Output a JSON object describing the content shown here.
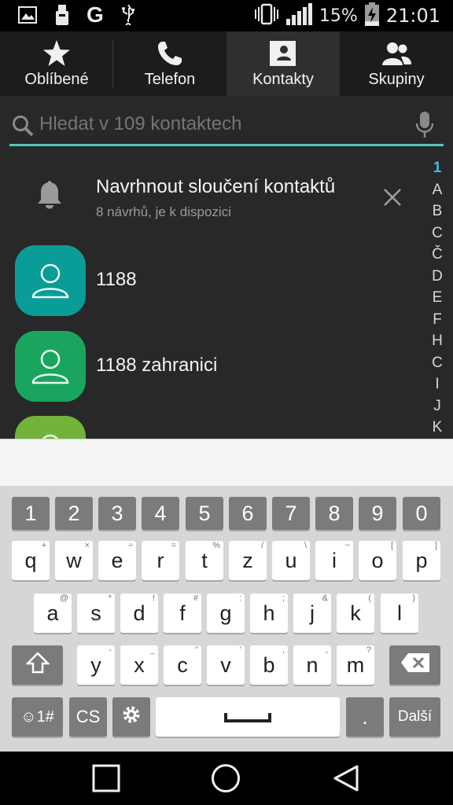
{
  "status": {
    "battery": "15%",
    "time": "21:01"
  },
  "tabs": [
    {
      "label": "Oblíbené",
      "icon": "star-icon"
    },
    {
      "label": "Telefon",
      "icon": "phone-icon"
    },
    {
      "label": "Kontakty",
      "icon": "contacts-icon",
      "active": true
    },
    {
      "label": "Skupiny",
      "icon": "groups-icon"
    }
  ],
  "search": {
    "placeholder": "Hledat v 109 kontaktech"
  },
  "suggestion": {
    "title": "Navrhnout sloučení kontaktů",
    "subtitle": "8 návrhů, je k dispozici"
  },
  "contacts": [
    {
      "name": "1188",
      "color": "#0a9c96"
    },
    {
      "name": "1188 zahranici",
      "color": "#1aa55e"
    },
    {
      "name": "",
      "color": "#74b33a"
    }
  ],
  "alphabet": [
    "1",
    "A",
    "B",
    "C",
    "Č",
    "D",
    "E",
    "F",
    "H",
    "C",
    "I",
    "J",
    "K"
  ],
  "keyboard": {
    "numbers": [
      "1",
      "2",
      "3",
      "4",
      "5",
      "6",
      "7",
      "8",
      "9",
      "0"
    ],
    "row1": [
      {
        "k": "q",
        "h": "+"
      },
      {
        "k": "w",
        "h": "×"
      },
      {
        "k": "e",
        "h": "÷"
      },
      {
        "k": "r",
        "h": "="
      },
      {
        "k": "t",
        "h": "%"
      },
      {
        "k": "z",
        "h": "/"
      },
      {
        "k": "u",
        "h": "\\"
      },
      {
        "k": "i",
        "h": "~"
      },
      {
        "k": "o",
        "h": "["
      },
      {
        "k": "p",
        "h": "]"
      }
    ],
    "row2": [
      {
        "k": "a",
        "h": "@"
      },
      {
        "k": "s",
        "h": "*"
      },
      {
        "k": "d",
        "h": "!"
      },
      {
        "k": "f",
        "h": "#"
      },
      {
        "k": "g",
        "h": ":"
      },
      {
        "k": "h",
        "h": ";"
      },
      {
        "k": "j",
        "h": "&"
      },
      {
        "k": "k",
        "h": "("
      },
      {
        "k": "l",
        "h": ")"
      }
    ],
    "row3": [
      {
        "k": "y",
        "h": "-"
      },
      {
        "k": "x",
        "h": "_"
      },
      {
        "k": "c",
        "h": "\""
      },
      {
        "k": "v",
        "h": "'"
      },
      {
        "k": "b",
        "h": ","
      },
      {
        "k": "n",
        "h": ","
      },
      {
        "k": "m",
        "h": "?"
      }
    ],
    "emoji_label": "☺1#",
    "lang_label": "CS",
    "period_label": ".",
    "action_label": "Další"
  }
}
